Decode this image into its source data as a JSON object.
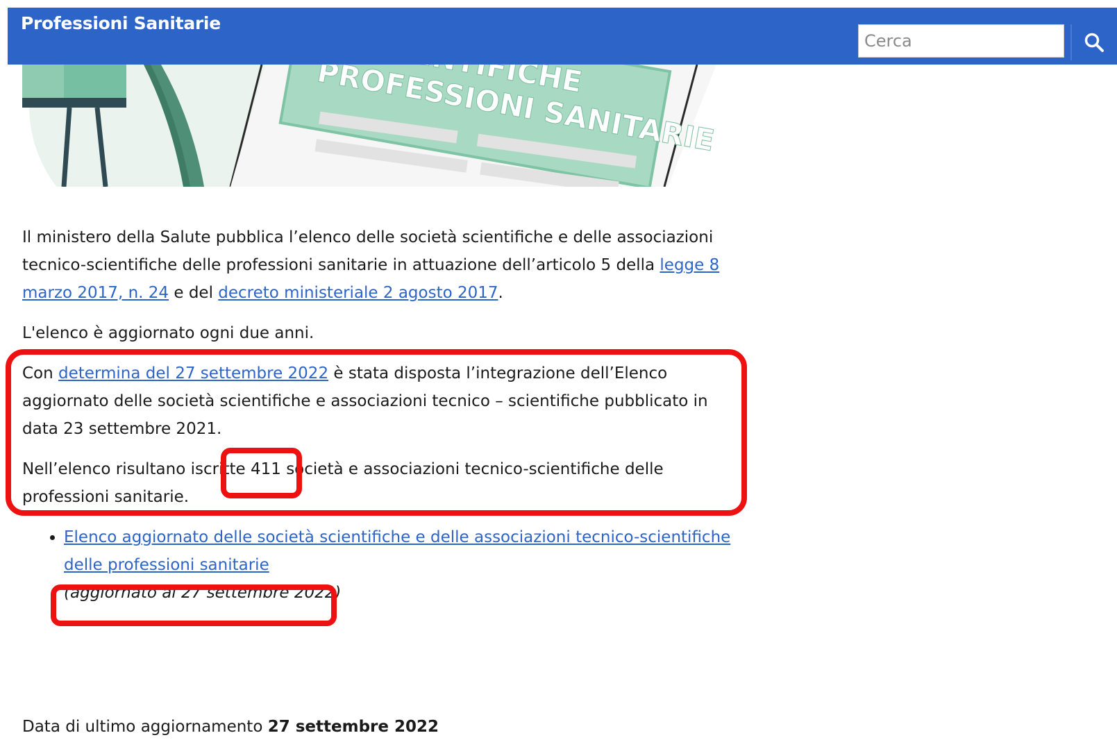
{
  "header": {
    "title": "Professioni Sanitarie",
    "search_placeholder": "Cerca",
    "search_icon": "search-icon",
    "background_color": "#2c64c8"
  },
  "hero": {
    "banner_line1": "O-SCIENTIFICHE",
    "banner_line2": "PROFESSIONI SANITARIE"
  },
  "intro": {
    "text_1": "Il ministero della Salute pubblica l’elenco delle società scientifiche e delle associazioni tecnico-scientifiche delle professioni sanitarie in attuazione dell’articolo 5 della ",
    "link_law": "legge 8 marzo 2017, n. 24",
    "text_2": " e del ",
    "link_decree": "decreto ministeriale 2 agosto 2017",
    "text_3": "."
  },
  "update_frequency": "L'elenco è aggiornato ogni due anni.",
  "integration": {
    "text_1": "Con ",
    "link_determina": "determina del 27 settembre 2022",
    "text_2": " è stata disposta l’integrazione dell’Elenco aggiornato delle società scientifiche e associazioni tecnico – scientifiche pubblicato in data 23 settembre 2021."
  },
  "count": {
    "text_1": "Nell’elenco risultano iscritte ",
    "number": "411",
    "text_2": " società e associazioni tecnico-scientifiche delle professioni sanitarie."
  },
  "list": {
    "items": [
      {
        "link": "Elenco aggiornato delle società scientifiche e delle associazioni tecnico-scientifiche delle professioni sanitarie",
        "note": "(aggiornato al 27 settembre  2022)"
      }
    ]
  },
  "footer": {
    "label": "Data di ultimo aggiornamento ",
    "date": "27 settembre 2022"
  },
  "highlight_color": "#ee1111"
}
